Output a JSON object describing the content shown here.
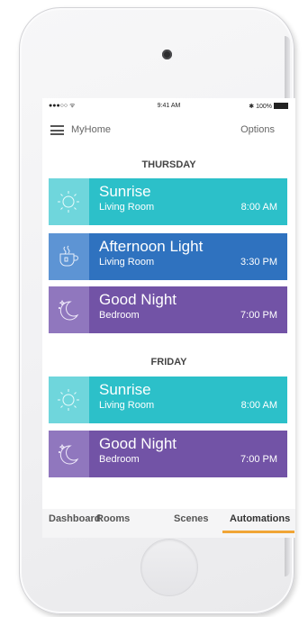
{
  "status_bar": {
    "signal": "●●●○○ ᯤ",
    "time": "9:41 AM",
    "battery": "✱ 100%"
  },
  "nav": {
    "title": "MyHome",
    "options_label": "Options"
  },
  "sections": [
    {
      "day": "THURSDAY",
      "items": [
        {
          "name": "Sunrise",
          "room": "Living Room",
          "time": "8:00 AM",
          "icon": "sun-icon",
          "color": "#2cc0c9",
          "icon_bg": "#6fd6dc"
        },
        {
          "name": "Afternoon Light",
          "room": "Living Room",
          "time": "3:30 PM",
          "icon": "tea-cup-icon",
          "color": "#2f72bf",
          "icon_bg": "#5d94d4"
        },
        {
          "name": "Good Night",
          "room": "Bedroom",
          "time": "7:00 PM",
          "icon": "moon-icon",
          "color": "#7253a6",
          "icon_bg": "#9077be"
        }
      ]
    },
    {
      "day": "FRIDAY",
      "items": [
        {
          "name": "Sunrise",
          "room": "Living Room",
          "time": "8:00 AM",
          "icon": "sun-icon",
          "color": "#2cc0c9",
          "icon_bg": "#6fd6dc"
        },
        {
          "name": "Good Night",
          "room": "Bedroom",
          "time": "7:00 PM",
          "icon": "moon-icon",
          "color": "#7253a6",
          "icon_bg": "#9077be"
        }
      ]
    }
  ],
  "tabs": [
    {
      "label": "Dashboard",
      "active": false
    },
    {
      "label": "Rooms",
      "active": false
    },
    {
      "label": "Scenes",
      "active": false
    },
    {
      "label": "Automations",
      "active": true
    }
  ],
  "accent_color": "#f0a536"
}
